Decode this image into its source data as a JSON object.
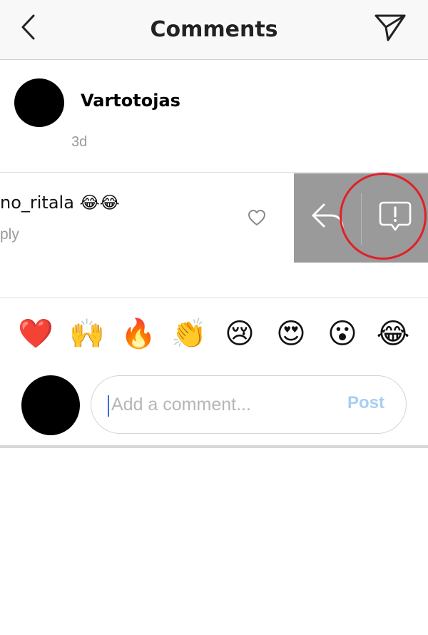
{
  "header": {
    "title": "Comments",
    "back_icon": "chevron-left-icon",
    "send_icon": "paper-plane-icon"
  },
  "caption": {
    "username": "Vartotojas",
    "time": "3d"
  },
  "comment": {
    "username_partial": "no_ritala",
    "emojis": "😂😂",
    "reply_label": "ply",
    "like_icon": "heart-outline-icon"
  },
  "swipe_actions": {
    "reply_icon": "reply-arrow-icon",
    "report_icon": "report-speech-bubble-icon",
    "background": "#9a9a9a",
    "highlight_color": "#e0202a"
  },
  "quick_emojis": [
    "❤️",
    "🙌",
    "🔥",
    "👏",
    "😢",
    "😍",
    "😮",
    "😂"
  ],
  "composer": {
    "placeholder": "Add a comment...",
    "value": "",
    "post_label": "Post",
    "post_color": "#a9cdf4"
  }
}
